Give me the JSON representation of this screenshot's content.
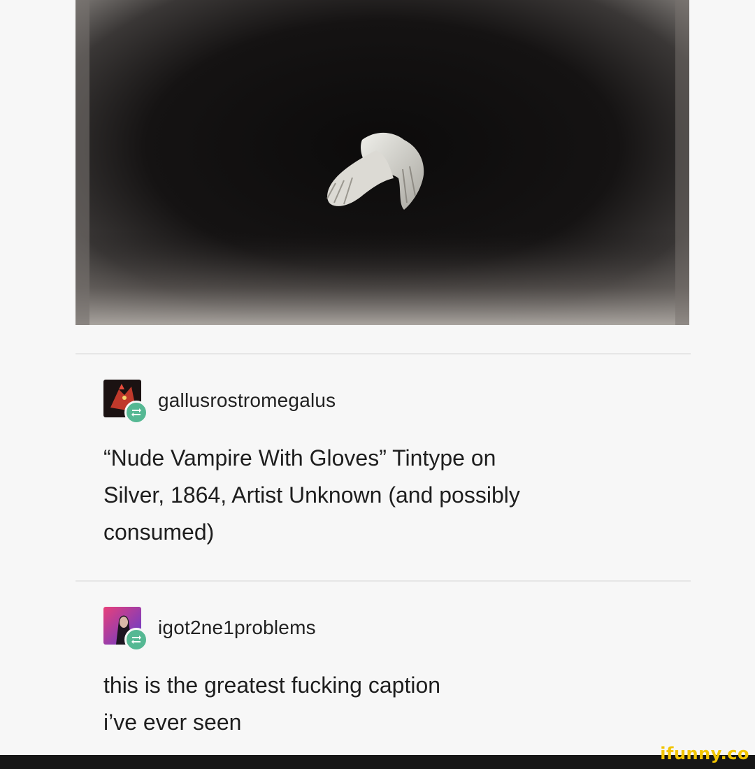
{
  "posts": [
    {
      "username": "gallusrostromegalus",
      "avatar_icon": "red-bird-avatar",
      "badge_icon": "reblog-icon",
      "text_lines": [
        "“Nude Vampire With Gloves”  Tintype on",
        "Silver, 1864, Artist Unknown (and possibly",
        "consumed)"
      ]
    },
    {
      "username": "igot2ne1problems",
      "avatar_icon": "character-portrait-avatar",
      "badge_icon": "reblog-icon",
      "text_lines": [
        "this is the greatest fucking caption",
        "i’ve ever seen"
      ]
    }
  ],
  "image": {
    "subject": "tintype-photo-gloves"
  },
  "watermark": "ifunny.co",
  "colors": {
    "background": "#f7f7f7",
    "reblog_badge": "#55b893",
    "watermark": "#f2c500",
    "footer_bar": "#161616"
  }
}
